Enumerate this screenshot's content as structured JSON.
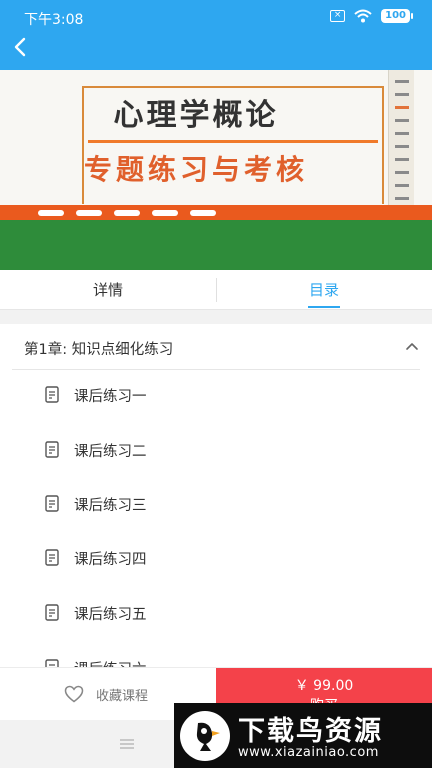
{
  "status_bar": {
    "time": "下午3:08",
    "battery": "100"
  },
  "banner": {
    "title": "心理学概论",
    "subtitle": "专题练习与考核"
  },
  "tabs": [
    {
      "label": "详情"
    },
    {
      "label": "目录"
    }
  ],
  "chapter": {
    "label": "第1章: 知识点细化练习",
    "lessons": [
      {
        "label": "课后练习一"
      },
      {
        "label": "课后练习二"
      },
      {
        "label": "课后练习三"
      },
      {
        "label": "课后练习四"
      },
      {
        "label": "课后练习五"
      },
      {
        "label": "课后练习六"
      }
    ]
  },
  "action_bar": {
    "favorite_label": "收藏课程",
    "price": "￥ 99.00",
    "buy_label": "购买"
  },
  "watermark": {
    "title": "下载鸟资源",
    "url": "www.xiazainiao.com"
  },
  "colors": {
    "accent": "#2ea7f0",
    "buy": "#f4424a",
    "banner_orange": "#ea5a1e",
    "banner_green": "#2e8c3a"
  }
}
